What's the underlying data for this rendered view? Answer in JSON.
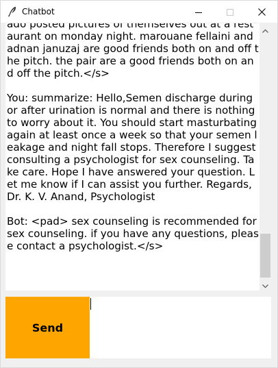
{
  "window": {
    "title": "Chatbot",
    "icon": "feather-icon"
  },
  "controls": {
    "minimize_icon": "minimize-icon",
    "maximize_icon": "maximize-icon",
    "close_icon": "close-icon"
  },
  "chat": {
    "log": "ado posted pictures of themselves out at a restaurant on monday night. marouane fellaini and adnan januzaj are good friends both on and off the pitch. the pair are a good friends both on and off the pitch.</s>\n\nYou: summarize: Hello,Semen discharge during or after urination is normal and there is nothing to worry about it. You should start masturbating again at least once a week so that your semen leakage and night fall stops. Therefore I suggest consulting a psychologist for sex counseling. Take care. Hope I have answered your question. Let me know if I can assist you further. Regards,Dr. K. V. Anand, Psychologist\n\nBot: <pad> sex counseling is recommended for sex counseling. if you have any questions, please contact a psychologist.</s>"
  },
  "scrollbar": {
    "up_icon": "scroll-up-arrow-icon",
    "down_icon": "scroll-down-arrow-icon"
  },
  "send": {
    "label": "Send"
  },
  "input": {
    "value": ""
  },
  "colors": {
    "send_bg": "#ffa500",
    "window_bg": "#f0f0f0",
    "text_bg": "#ffffff"
  }
}
